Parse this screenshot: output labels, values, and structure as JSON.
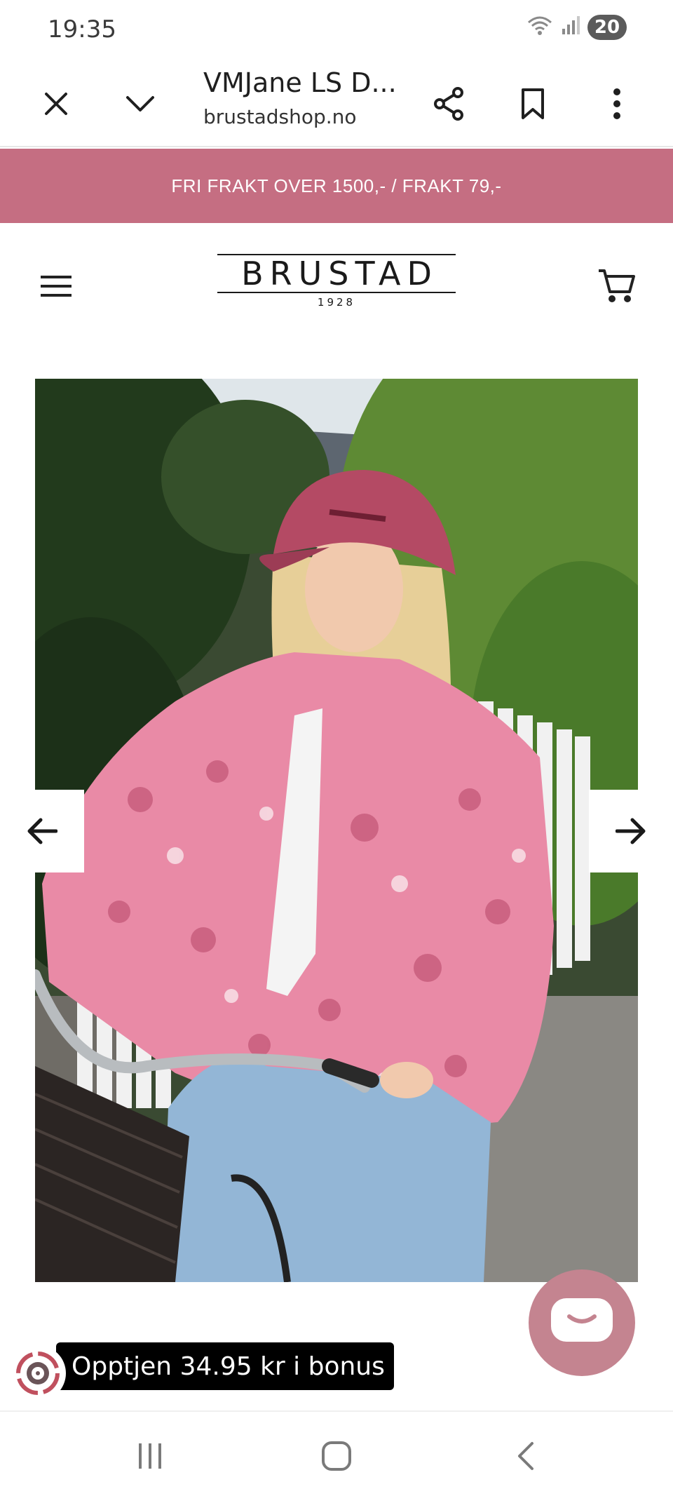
{
  "status_bar": {
    "time": "19:35",
    "battery": "20",
    "icons": [
      "wifi-icon",
      "signal-icon",
      "battery-icon"
    ]
  },
  "toolbar": {
    "title": "VMJane LS D...",
    "url": "brustadshop.no",
    "icons": [
      "close-icon",
      "chevron-down-icon",
      "share-icon",
      "bookmark-icon",
      "more-vert-icon"
    ]
  },
  "promo": {
    "text": "FRI FRAKT OVER 1500,- / FRAKT 79,-"
  },
  "header": {
    "logo_text": "BRUSTAD",
    "logo_year": "1928",
    "icons": [
      "hamburger-menu-icon",
      "cart-icon"
    ]
  },
  "carousel": {
    "icons": [
      "arrow-left-icon",
      "arrow-right-icon"
    ]
  },
  "bonus": {
    "text": "Opptjen 34.95 kr i bonus",
    "icon": "bonus-icon"
  },
  "chat": {
    "icon": "chat-icon"
  },
  "system_nav": {
    "icons": [
      "recents-icon",
      "home-icon",
      "back-icon"
    ]
  },
  "colors": {
    "promo_bg": "#c56e82",
    "chat_bg": "#c48490",
    "bonus_bg": "#000000",
    "jacket_pink": "#e98aa6",
    "cap": "#b44a64",
    "jeans": "#93b6d6"
  }
}
